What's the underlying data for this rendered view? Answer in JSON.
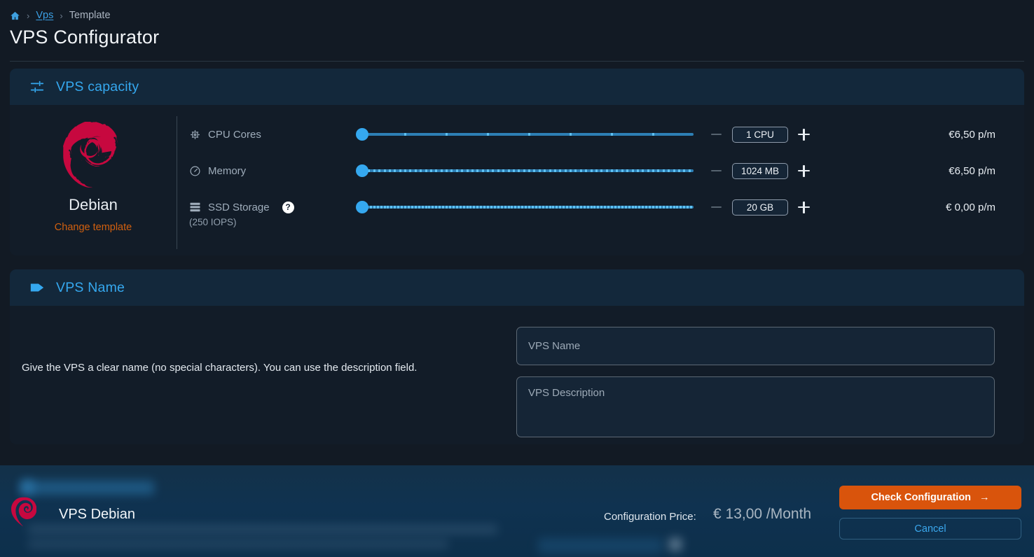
{
  "breadcrumb": {
    "home_icon": "home-icon",
    "separator": "›",
    "link": "Vps",
    "current": "Template"
  },
  "page_title": "VPS Configurator",
  "capacity_card": {
    "icon": "tune-sliders-icon",
    "title": "VPS capacity",
    "os": {
      "logo_icon": "debian-swirl-logo",
      "name": "Debian",
      "change_link": "Change template"
    },
    "rows": [
      {
        "icon": "cpu-chip-icon",
        "label": "CPU Cores",
        "value": "1 CPU",
        "price": "€6,50 p/m",
        "minus": "−",
        "plus": "+",
        "tick_count": 7,
        "thumb_pct": 0
      },
      {
        "icon": "memory-gauge-icon",
        "label": "Memory",
        "value": "1024 MB",
        "price": "€6,50 p/m",
        "minus": "−",
        "plus": "+",
        "tick_count": 63,
        "thumb_pct": 0
      },
      {
        "icon": "storage-disks-icon",
        "label": "SSD Storage",
        "label_note": "(250 IOPS)",
        "help_icon": "question-mark-icon",
        "help_glyph": "?",
        "value": "20 GB",
        "price": "€ 0,00 p/m",
        "minus": "−",
        "plus": "+",
        "tick_count": 95,
        "thumb_pct": 0
      }
    ]
  },
  "name_card": {
    "icon": "tag-label-icon",
    "title": "VPS Name",
    "description": "Give the VPS a clear name (no special characters). You can use the description field.",
    "name_placeholder": "VPS Name",
    "name_value": "",
    "description_placeholder": "VPS Description",
    "description_value": ""
  },
  "bottom_bar": {
    "logo_icon": "debian-swirl-logo",
    "vps_name": "VPS Debian",
    "price_label": "Configuration Price:",
    "price_value": "€ 13,00 /Month",
    "check_button": "Check Configuration",
    "check_arrow": "→",
    "cancel_button": "Cancel"
  },
  "colors": {
    "page_bg": "#121a24",
    "card_bg": "#121c28",
    "card_header_bg": "#13283b",
    "accent_blue": "#35a8ef",
    "accent_orange": "#d9540c",
    "debian_red": "#c7083f",
    "slider_track": "#2d7fb5",
    "tick": "#5ec0f0"
  }
}
